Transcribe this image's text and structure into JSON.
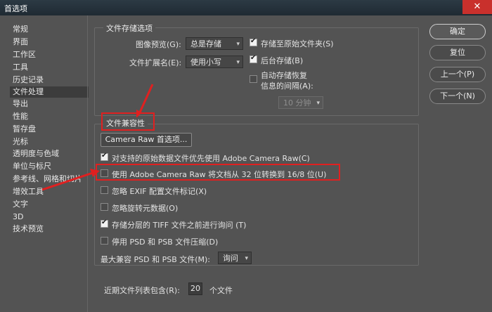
{
  "window": {
    "title": "首选项",
    "close_icon": "close-icon"
  },
  "sidebar": {
    "items": [
      {
        "label": "常规"
      },
      {
        "label": "界面"
      },
      {
        "label": "工作区"
      },
      {
        "label": "工具"
      },
      {
        "label": "历史记录"
      },
      {
        "label": "文件处理"
      },
      {
        "label": "导出"
      },
      {
        "label": "性能"
      },
      {
        "label": "暂存盘"
      },
      {
        "label": "光标"
      },
      {
        "label": "透明度与色域"
      },
      {
        "label": "单位与标尺"
      },
      {
        "label": "参考线、网格和切片"
      },
      {
        "label": "增效工具"
      },
      {
        "label": "文字"
      },
      {
        "label": "3D"
      },
      {
        "label": "技术预览"
      }
    ],
    "selected": "文件处理"
  },
  "save_options": {
    "title": "文件存储选项",
    "image_preview_label": "图像预览(G):",
    "image_preview_value": "总是存储",
    "ext_label": "文件扩展名(E):",
    "ext_value": "使用小写",
    "save_to_original": "存储至原始文件夹(S)",
    "save_to_original_checked": true,
    "bg_save": "后台存储(B)",
    "bg_save_checked": true,
    "autosave_label_1": "自动存储恢复",
    "autosave_label_2": "信息的间隔(A):",
    "autosave_checked": false,
    "interval_value": "10 分钟"
  },
  "compat": {
    "title": "文件兼容性",
    "camera_raw_button": "Camera Raw 首选项...",
    "options": [
      {
        "label": "对支持的原始数据文件优先使用 Adobe Camera Raw(C)",
        "checked": true
      },
      {
        "label": "使用 Adobe Camera Raw 将文档从 32 位转换到 16/8 位(U)",
        "checked": false
      },
      {
        "label": "忽略 EXIF 配置文件标记(X)",
        "checked": false
      },
      {
        "label": "忽略旋转元数据(O)",
        "checked": false
      },
      {
        "label": "存储分层的 TIFF 文件之前进行询问 (T)",
        "checked": true
      },
      {
        "label": "停用 PSD 和 PSB 文件压缩(D)",
        "checked": false
      }
    ],
    "max_compat_label": "最大兼容 PSD 和 PSB 文件(M):",
    "max_compat_value": "询问"
  },
  "recent": {
    "label": "近期文件列表包含(R):",
    "value": "20",
    "suffix": "个文件"
  },
  "buttons": {
    "ok": "确定",
    "reset": "复位",
    "prev": "上一个(P)",
    "next": "下一个(N)"
  },
  "colors": {
    "accent_red": "#e02020",
    "bg": "#535353"
  }
}
